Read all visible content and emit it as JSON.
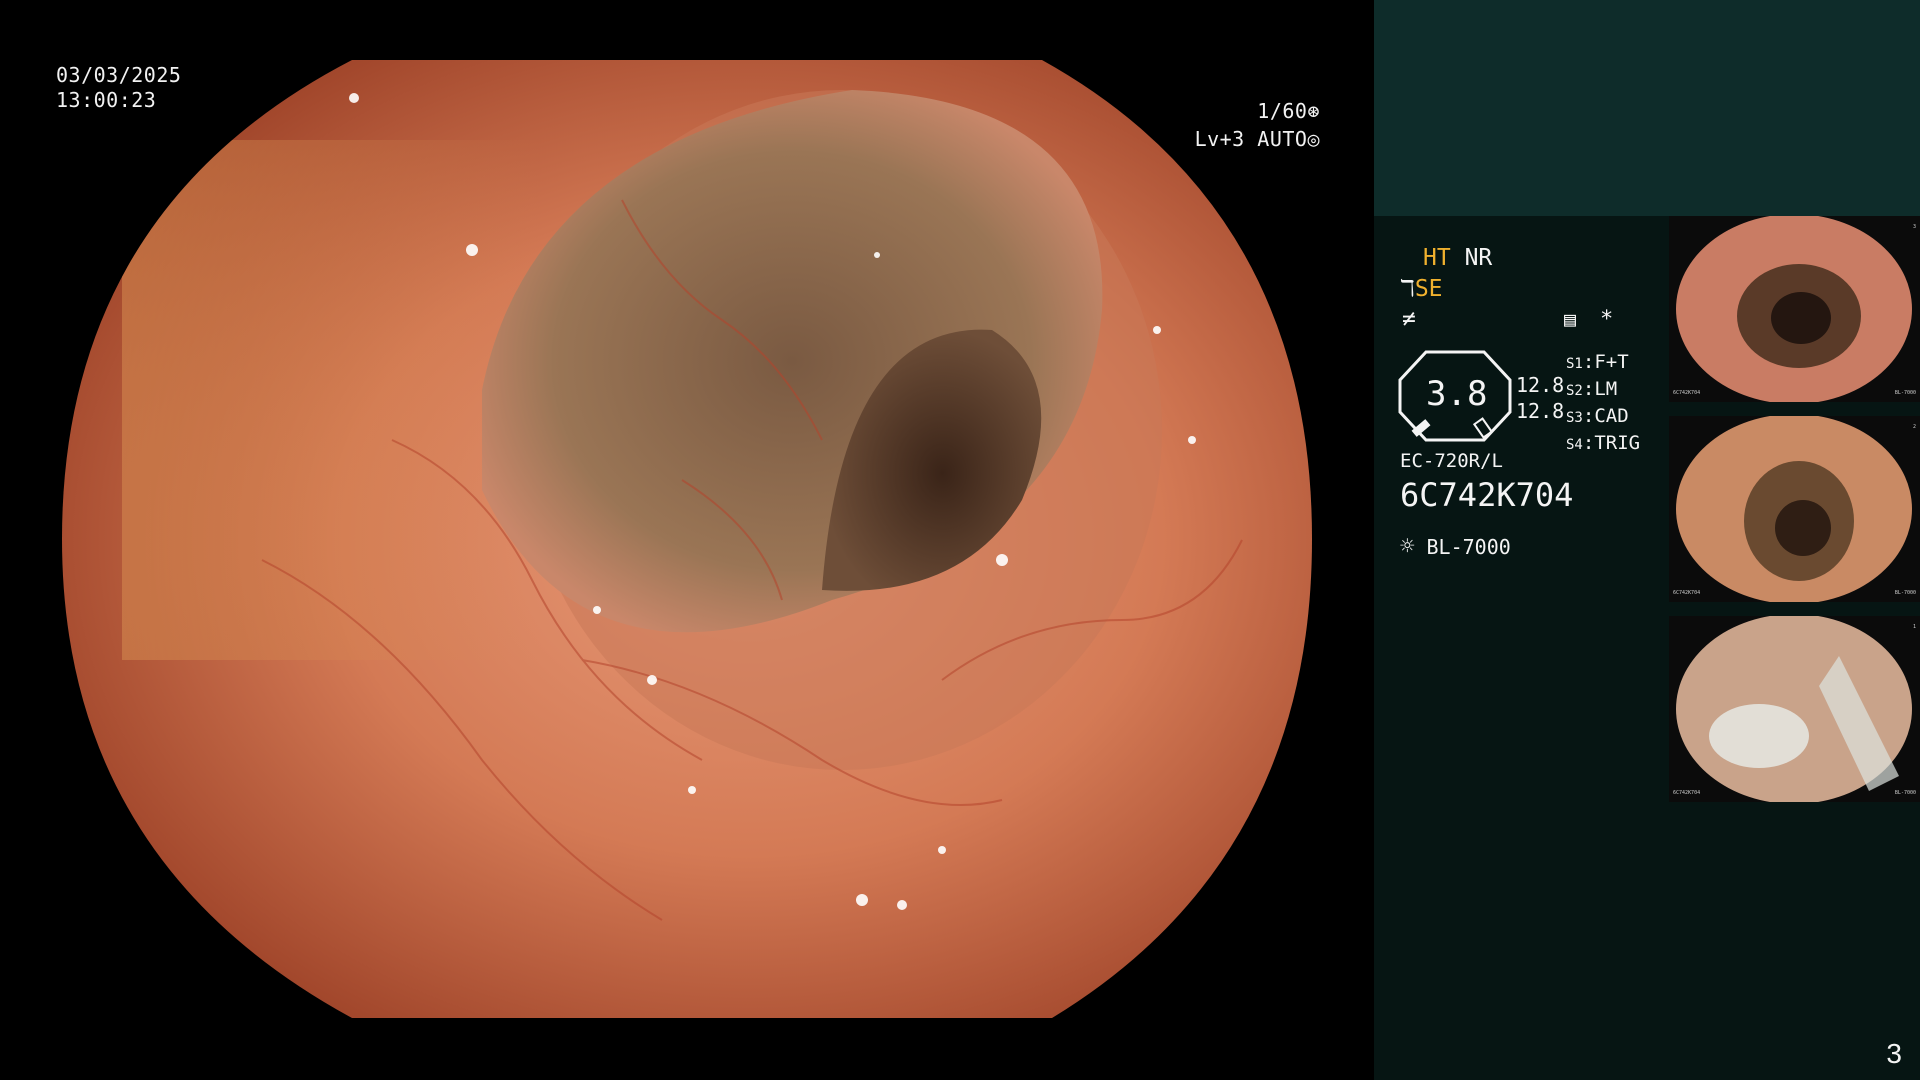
{
  "overlay": {
    "date": "03/03/2025",
    "time": "13:00:23",
    "shutter": "1/60",
    "level": "Lv+3",
    "mode": "AUTO"
  },
  "settings": {
    "ht": "HT",
    "nr": "NR",
    "se": "SE",
    "zoom": "3.8",
    "left_value_1": "12.8",
    "left_value_2": "12.8",
    "switches": [
      {
        "key": "S1",
        "value": "F+T"
      },
      {
        "key": "S2",
        "value": "LM"
      },
      {
        "key": "S3",
        "value": "CAD"
      },
      {
        "key": "S4",
        "value": "TRIG"
      }
    ],
    "scope_model": "EC-720R/L",
    "serial": "6C742K704",
    "light_source": "BL-7000"
  },
  "thumbnails": [
    {
      "index": "3",
      "serial": "6C742K704",
      "light": "BL-7000"
    },
    {
      "index": "2",
      "serial": "6C742K704",
      "light": "BL-7000"
    },
    {
      "index": "1",
      "serial": "6C742K704",
      "light": "BL-7000"
    }
  ],
  "page_number": "3",
  "colors": {
    "highlight": "#f0b12e",
    "panel": "#061513",
    "panel_top": "#0e2c2a"
  }
}
